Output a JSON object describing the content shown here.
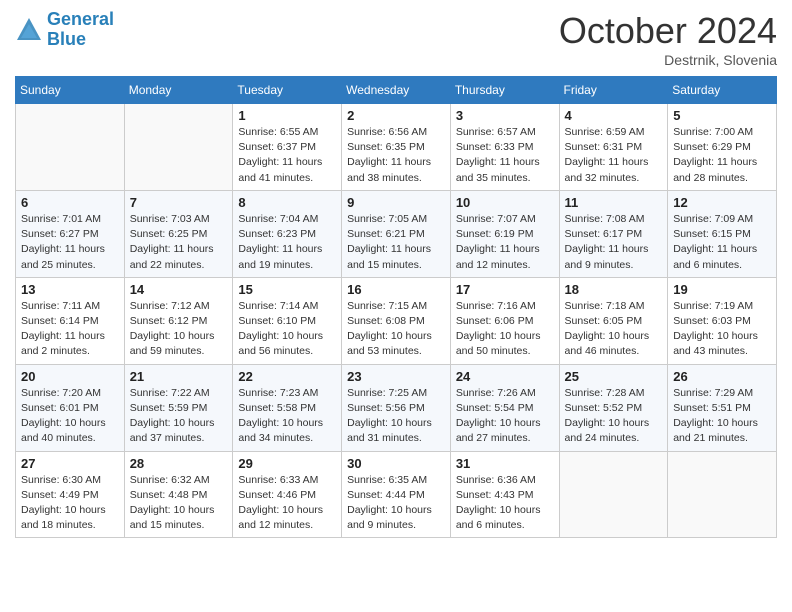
{
  "header": {
    "logo_line1": "General",
    "logo_line2": "Blue",
    "month_title": "October 2024",
    "location": "Destrnik, Slovenia"
  },
  "days_of_week": [
    "Sunday",
    "Monday",
    "Tuesday",
    "Wednesday",
    "Thursday",
    "Friday",
    "Saturday"
  ],
  "weeks": [
    [
      {
        "day": "",
        "info": ""
      },
      {
        "day": "",
        "info": ""
      },
      {
        "day": "1",
        "info": "Sunrise: 6:55 AM\nSunset: 6:37 PM\nDaylight: 11 hours and 41 minutes."
      },
      {
        "day": "2",
        "info": "Sunrise: 6:56 AM\nSunset: 6:35 PM\nDaylight: 11 hours and 38 minutes."
      },
      {
        "day": "3",
        "info": "Sunrise: 6:57 AM\nSunset: 6:33 PM\nDaylight: 11 hours and 35 minutes."
      },
      {
        "day": "4",
        "info": "Sunrise: 6:59 AM\nSunset: 6:31 PM\nDaylight: 11 hours and 32 minutes."
      },
      {
        "day": "5",
        "info": "Sunrise: 7:00 AM\nSunset: 6:29 PM\nDaylight: 11 hours and 28 minutes."
      }
    ],
    [
      {
        "day": "6",
        "info": "Sunrise: 7:01 AM\nSunset: 6:27 PM\nDaylight: 11 hours and 25 minutes."
      },
      {
        "day": "7",
        "info": "Sunrise: 7:03 AM\nSunset: 6:25 PM\nDaylight: 11 hours and 22 minutes."
      },
      {
        "day": "8",
        "info": "Sunrise: 7:04 AM\nSunset: 6:23 PM\nDaylight: 11 hours and 19 minutes."
      },
      {
        "day": "9",
        "info": "Sunrise: 7:05 AM\nSunset: 6:21 PM\nDaylight: 11 hours and 15 minutes."
      },
      {
        "day": "10",
        "info": "Sunrise: 7:07 AM\nSunset: 6:19 PM\nDaylight: 11 hours and 12 minutes."
      },
      {
        "day": "11",
        "info": "Sunrise: 7:08 AM\nSunset: 6:17 PM\nDaylight: 11 hours and 9 minutes."
      },
      {
        "day": "12",
        "info": "Sunrise: 7:09 AM\nSunset: 6:15 PM\nDaylight: 11 hours and 6 minutes."
      }
    ],
    [
      {
        "day": "13",
        "info": "Sunrise: 7:11 AM\nSunset: 6:14 PM\nDaylight: 11 hours and 2 minutes."
      },
      {
        "day": "14",
        "info": "Sunrise: 7:12 AM\nSunset: 6:12 PM\nDaylight: 10 hours and 59 minutes."
      },
      {
        "day": "15",
        "info": "Sunrise: 7:14 AM\nSunset: 6:10 PM\nDaylight: 10 hours and 56 minutes."
      },
      {
        "day": "16",
        "info": "Sunrise: 7:15 AM\nSunset: 6:08 PM\nDaylight: 10 hours and 53 minutes."
      },
      {
        "day": "17",
        "info": "Sunrise: 7:16 AM\nSunset: 6:06 PM\nDaylight: 10 hours and 50 minutes."
      },
      {
        "day": "18",
        "info": "Sunrise: 7:18 AM\nSunset: 6:05 PM\nDaylight: 10 hours and 46 minutes."
      },
      {
        "day": "19",
        "info": "Sunrise: 7:19 AM\nSunset: 6:03 PM\nDaylight: 10 hours and 43 minutes."
      }
    ],
    [
      {
        "day": "20",
        "info": "Sunrise: 7:20 AM\nSunset: 6:01 PM\nDaylight: 10 hours and 40 minutes."
      },
      {
        "day": "21",
        "info": "Sunrise: 7:22 AM\nSunset: 5:59 PM\nDaylight: 10 hours and 37 minutes."
      },
      {
        "day": "22",
        "info": "Sunrise: 7:23 AM\nSunset: 5:58 PM\nDaylight: 10 hours and 34 minutes."
      },
      {
        "day": "23",
        "info": "Sunrise: 7:25 AM\nSunset: 5:56 PM\nDaylight: 10 hours and 31 minutes."
      },
      {
        "day": "24",
        "info": "Sunrise: 7:26 AM\nSunset: 5:54 PM\nDaylight: 10 hours and 27 minutes."
      },
      {
        "day": "25",
        "info": "Sunrise: 7:28 AM\nSunset: 5:52 PM\nDaylight: 10 hours and 24 minutes."
      },
      {
        "day": "26",
        "info": "Sunrise: 7:29 AM\nSunset: 5:51 PM\nDaylight: 10 hours and 21 minutes."
      }
    ],
    [
      {
        "day": "27",
        "info": "Sunrise: 6:30 AM\nSunset: 4:49 PM\nDaylight: 10 hours and 18 minutes."
      },
      {
        "day": "28",
        "info": "Sunrise: 6:32 AM\nSunset: 4:48 PM\nDaylight: 10 hours and 15 minutes."
      },
      {
        "day": "29",
        "info": "Sunrise: 6:33 AM\nSunset: 4:46 PM\nDaylight: 10 hours and 12 minutes."
      },
      {
        "day": "30",
        "info": "Sunrise: 6:35 AM\nSunset: 4:44 PM\nDaylight: 10 hours and 9 minutes."
      },
      {
        "day": "31",
        "info": "Sunrise: 6:36 AM\nSunset: 4:43 PM\nDaylight: 10 hours and 6 minutes."
      },
      {
        "day": "",
        "info": ""
      },
      {
        "day": "",
        "info": ""
      }
    ]
  ]
}
